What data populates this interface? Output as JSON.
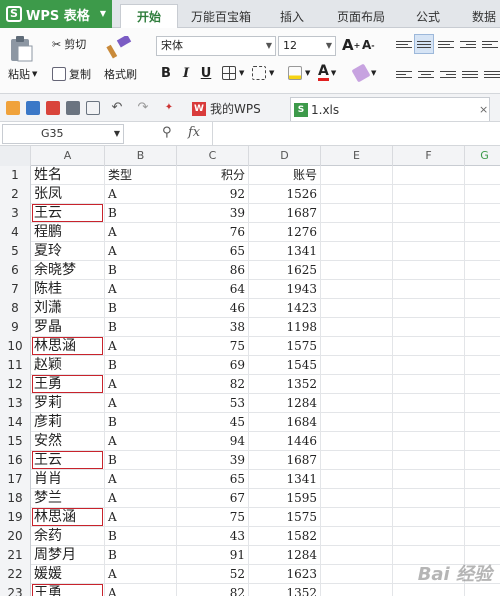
{
  "app": {
    "title": "WPS 表格",
    "logo_letter": "S"
  },
  "tabs": [
    "开始",
    "万能百宝箱",
    "插入",
    "页面布局",
    "公式",
    "数据"
  ],
  "ribbon": {
    "paste": "粘贴",
    "cut": "剪切",
    "copy": "复制",
    "format_painter": "格式刷",
    "font_name": "宋体",
    "font_size": "12",
    "bold": "B",
    "italic": "I",
    "underline": "U",
    "grow_font": "A",
    "shrink_font": "A"
  },
  "quick_access": {
    "doc_tabs": [
      "我的WPS",
      "1.xls"
    ]
  },
  "formula_bar": {
    "cell_ref": "G35",
    "fx": "fx"
  },
  "sheet": {
    "columns": [
      "A",
      "B",
      "C",
      "D",
      "E",
      "F",
      "G"
    ],
    "rows": [
      {
        "n": "1",
        "a": "姓名",
        "b": "类型",
        "c": "积分",
        "d": "账号",
        "hl": false
      },
      {
        "n": "2",
        "a": "张凤",
        "b": "A",
        "c": "92",
        "d": "1526",
        "hl": false
      },
      {
        "n": "3",
        "a": "王云",
        "b": "B",
        "c": "39",
        "d": "1687",
        "hl": true
      },
      {
        "n": "4",
        "a": "程鹏",
        "b": "A",
        "c": "76",
        "d": "1276",
        "hl": false
      },
      {
        "n": "5",
        "a": "夏玲",
        "b": "A",
        "c": "65",
        "d": "1341",
        "hl": false
      },
      {
        "n": "6",
        "a": "余晓梦",
        "b": "B",
        "c": "86",
        "d": "1625",
        "hl": false
      },
      {
        "n": "7",
        "a": "陈桂",
        "b": "A",
        "c": "64",
        "d": "1943",
        "hl": false
      },
      {
        "n": "8",
        "a": "刘潇",
        "b": "B",
        "c": "46",
        "d": "1423",
        "hl": false
      },
      {
        "n": "9",
        "a": "罗晶",
        "b": "B",
        "c": "38",
        "d": "1198",
        "hl": false
      },
      {
        "n": "10",
        "a": "林思涵",
        "b": "A",
        "c": "75",
        "d": "1575",
        "hl": true
      },
      {
        "n": "11",
        "a": "赵颖",
        "b": "B",
        "c": "69",
        "d": "1545",
        "hl": false
      },
      {
        "n": "12",
        "a": "王勇",
        "b": "A",
        "c": "82",
        "d": "1352",
        "hl": true
      },
      {
        "n": "13",
        "a": "罗莉",
        "b": "A",
        "c": "53",
        "d": "1284",
        "hl": false
      },
      {
        "n": "14",
        "a": "彦莉",
        "b": "B",
        "c": "45",
        "d": "1684",
        "hl": false
      },
      {
        "n": "15",
        "a": "安然",
        "b": "A",
        "c": "94",
        "d": "1446",
        "hl": false
      },
      {
        "n": "16",
        "a": "王云",
        "b": "B",
        "c": "39",
        "d": "1687",
        "hl": true
      },
      {
        "n": "17",
        "a": "肖肖",
        "b": "A",
        "c": "65",
        "d": "1341",
        "hl": false
      },
      {
        "n": "18",
        "a": "梦兰",
        "b": "A",
        "c": "67",
        "d": "1595",
        "hl": false
      },
      {
        "n": "19",
        "a": "林思涵",
        "b": "A",
        "c": "75",
        "d": "1575",
        "hl": true
      },
      {
        "n": "20",
        "a": "余药",
        "b": "B",
        "c": "43",
        "d": "1582",
        "hl": false
      },
      {
        "n": "21",
        "a": "周梦月",
        "b": "B",
        "c": "91",
        "d": "1284",
        "hl": false
      },
      {
        "n": "22",
        "a": "媛媛",
        "b": "A",
        "c": "52",
        "d": "1623",
        "hl": false
      },
      {
        "n": "23",
        "a": "王勇",
        "b": "A",
        "c": "82",
        "d": "1352",
        "hl": true
      }
    ]
  },
  "watermark": "Bai 经验",
  "colors": {
    "brand": "#3d9a4a",
    "highlight_border": "#c8232c"
  }
}
